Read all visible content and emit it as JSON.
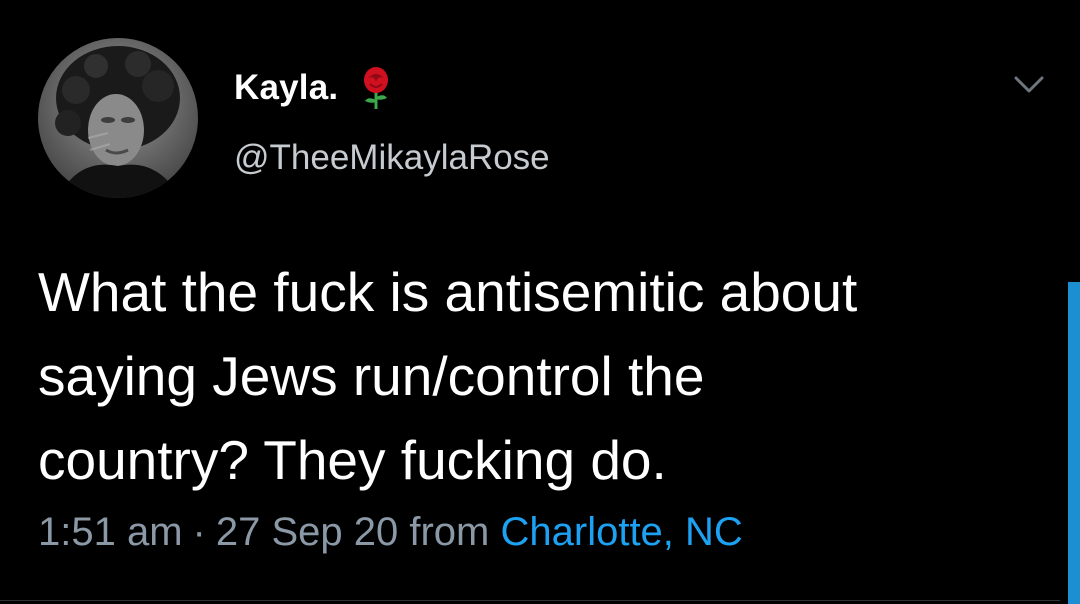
{
  "tweet": {
    "author": {
      "display_name": "Kayla.",
      "handle": "@TheeMikaylaRose",
      "name_emoji": "rose-icon",
      "avatar": "avatar-photo"
    },
    "text": "What the fuck is antisemitic about\nsaying Jews run/control the\ncountry? They fucking do.",
    "time": "1:51 am",
    "separator": "·",
    "date": "27 Sep 20",
    "source_prefix": "from",
    "location": "Charlotte, NC",
    "menu_icon": "chevron-down-icon"
  },
  "colors": {
    "background": "#000000",
    "text": "#ffffff",
    "secondary_text": "#8b98a5",
    "link": "#1da1f2",
    "scrollbar": "#1c8fd3"
  }
}
